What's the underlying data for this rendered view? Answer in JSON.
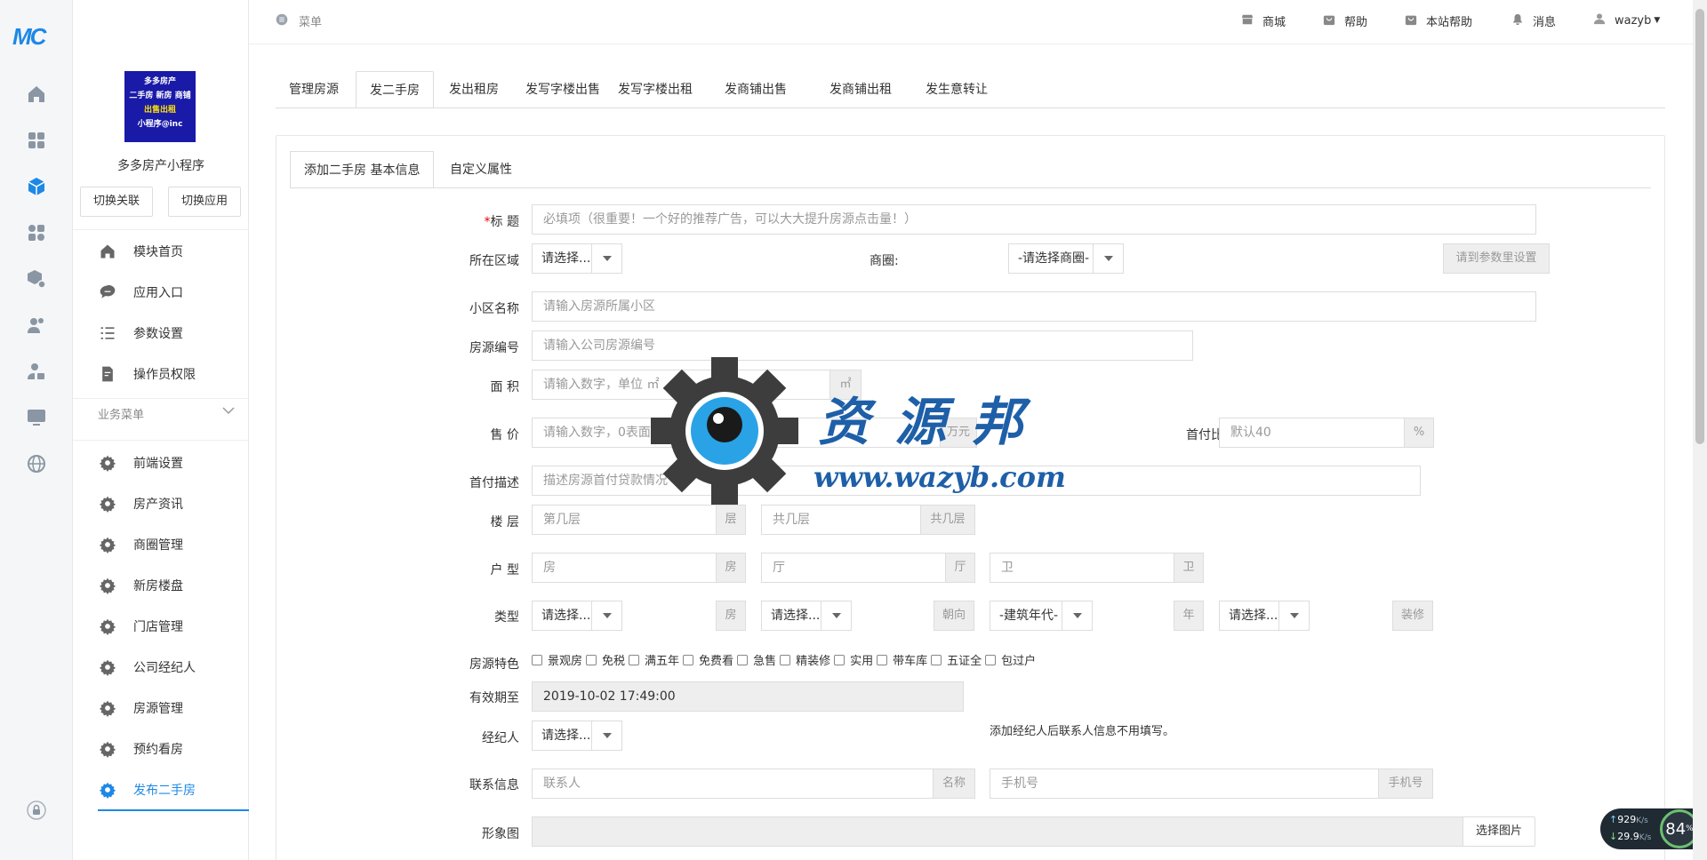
{
  "rail": {
    "logo": "MC",
    "icons": [
      "home-icon",
      "grid-icon",
      "cube-icon",
      "apps-icon",
      "box-settings-icon",
      "users-icon",
      "user-lock-icon",
      "monitor-icon",
      "globe-icon",
      "lock-icon"
    ]
  },
  "sidebar": {
    "app_image_lines": [
      "多多房产",
      "二手房 新房 商铺",
      "出售出租",
      "小程序@inc"
    ],
    "app_name": "多多房产小程序",
    "switch_link_label": "切换关联",
    "switch_app_label": "切换应用",
    "main_items": [
      {
        "label": "模块首页",
        "icon": "home-icon"
      },
      {
        "label": "应用入口",
        "icon": "chat-icon"
      },
      {
        "label": "参数设置",
        "icon": "list-icon"
      },
      {
        "label": "操作员权限",
        "icon": "document-edit-icon"
      }
    ],
    "business_header": "业务菜单",
    "business_items": [
      {
        "label": "前端设置"
      },
      {
        "label": "房产资讯"
      },
      {
        "label": "商圈管理"
      },
      {
        "label": "新房楼盘"
      },
      {
        "label": "门店管理"
      },
      {
        "label": "公司经纪人"
      },
      {
        "label": "房源管理"
      },
      {
        "label": "预约看房"
      },
      {
        "label": "发布二手房"
      }
    ],
    "active_item": "发布二手房"
  },
  "header": {
    "menu_label": "菜单",
    "links": [
      {
        "label": "商城",
        "icon": "store-icon"
      },
      {
        "label": "帮助",
        "icon": "bag-icon"
      },
      {
        "label": "本站帮助",
        "icon": "bag-icon"
      },
      {
        "label": "消息",
        "icon": "bell-icon"
      },
      {
        "label": "wazyb",
        "icon": "user-icon"
      }
    ]
  },
  "tabs": [
    "管理房源",
    "发二手房",
    "发出租房",
    "发写字楼出售",
    "发写字楼出租",
    "发商铺出售",
    "发商铺出租",
    "发生意转让"
  ],
  "active_tab": "发二手房",
  "subtabs": [
    "添加二手房 基本信息",
    "自定义属性"
  ],
  "form": {
    "title_label": "标 题",
    "title_placeholder": "必填项（很重要！一个好的推荐广告，可以大大提升房源点击量！）",
    "area_label": "所在区域",
    "area_value": "请选择...",
    "circle_label": "商圈:",
    "circle_value": "-请选择商圈-",
    "circle_btn": "请到参数里设置",
    "community_label": "小区名称",
    "community_placeholder": "请输入房源所属小区",
    "code_label": "房源编号",
    "code_placeholder": "请输入公司房源编号",
    "size_label": "面 积",
    "size_placeholder": "请输入数字，单位 ㎡",
    "size_unit": "㎡",
    "price_label": "售 价",
    "price_placeholder": "请输入数字，0表面议",
    "price_unit": "万元",
    "down_label": "首付比例",
    "down_placeholder": "默认40",
    "down_unit": "%",
    "down_desc_label": "首付描述",
    "down_desc_placeholder": "描述房源首付贷款情况",
    "floor_label": "楼 层",
    "floor_placeholder": "第几层",
    "floor_unit": "层",
    "total_floor_placeholder": "共几层",
    "total_floor_unit": "共几层",
    "layout_label": "户 型",
    "room_placeholder": "房",
    "room_unit": "房",
    "hall_placeholder": "厅",
    "hall_unit": "厅",
    "bath_placeholder": "卫",
    "bath_unit": "卫",
    "type_label": "类型",
    "type_value": "请选择...",
    "type_unit": "房",
    "orient_value": "请选择...",
    "orient_unit": "朝向",
    "year_value": "-建筑年代-",
    "year_unit": "年",
    "decor_value": "请选择...",
    "decor_unit": "装修",
    "features_label": "房源特色",
    "features": [
      "景观房",
      "免税",
      "满五年",
      "免费看",
      "急售",
      "精装修",
      "实用",
      "带车库",
      "五证全",
      "包过户"
    ],
    "expire_label": "有效期至",
    "expire_value": "2019-10-02 17:49:00",
    "agent_label": "经纪人",
    "agent_value": "请选择...",
    "agent_note": "添加经纪人后联系人信息不用填写。",
    "contact_label": "联系信息",
    "contact_placeholder": "联系人",
    "contact_unit": "名称",
    "phone_placeholder": "手机号",
    "phone_unit": "手机号",
    "image_label": "形象图",
    "image_btn": "选择图片"
  },
  "watermark": {
    "brand": "资 源 邦",
    "url": "www.wazyb.com"
  },
  "speed": {
    "up": "929",
    "down": "29.9",
    "unit": "K/s",
    "percent": "84",
    "percent_unit": "%"
  },
  "colors": {
    "accent": "#1e88e5",
    "required": "#ee0000"
  }
}
